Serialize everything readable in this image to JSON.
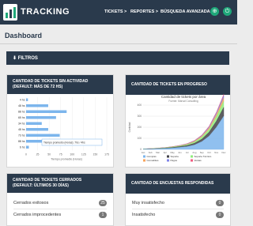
{
  "header": {
    "brand": "TRACKING",
    "nav": [
      "TICKETS >",
      "REPORTES >",
      "BÚSQUEDA AVANZADA >"
    ],
    "icon1": "account-icon",
    "icon2": "logout-icon"
  },
  "page": {
    "title": "Dashboard"
  },
  "filters": {
    "label": "⬇ FILTROS"
  },
  "cards": {
    "inactive": {
      "title_1": "CANTIDAD DE TICKETS SIN ACTIVIDAD",
      "title_2": "(DEFAULT: MÁS DE 72 HS)"
    },
    "progress": {
      "title": "CANTIDAD DE TICKETS EN PROGRESO"
    },
    "closed": {
      "title_1": "CANTIDAD DE TICKETS CERRADOS",
      "title_2": "(DEFAULT: ÚLTIMOS 30 DÍAS)",
      "rows": [
        {
          "label": "Cerrados exitosos",
          "count": "25"
        },
        {
          "label": "Cerrados improcedentes",
          "count": "1"
        }
      ]
    },
    "surveys": {
      "title": "CANTIDAD DE ENCUESTAS RESPONDIDAS",
      "rows": [
        {
          "label": "Muy insatisfecho",
          "count": "0"
        },
        {
          "label": "Insatisfecho",
          "count": "0"
        }
      ]
    }
  },
  "chart_data": [
    {
      "type": "bar",
      "orientation": "horizontal",
      "xlabel": "Tiempo promedio (Horas)",
      "xticks": [
        "0",
        "25",
        "50",
        "75",
        "100",
        "125",
        "150",
        "175"
      ],
      "xlim": [
        0,
        175
      ],
      "data_labels": [
        "4 hs",
        "48 hs",
        "88 hs",
        "65 hs",
        "34 hs",
        "48 hs",
        "73 hs",
        "88 hs",
        "6 hs"
      ],
      "values": [
        4,
        48,
        88,
        65,
        34,
        48,
        73,
        88,
        6
      ],
      "tooltip": "Tiempo promedio (Horas): 7hs / 4hs"
    },
    {
      "type": "area",
      "title": "Cantidad de tickets por área",
      "subtitle": "Fuente: Marval Consulting",
      "ylabel": "Cantidad",
      "xticks": [
        "Jan",
        "Feb",
        "Mar",
        "Apr",
        "May",
        "Jun",
        "Jul",
        "Aug",
        "Sep",
        "Oct",
        "Nov",
        "Dec"
      ],
      "yticks": [
        "0",
        "100",
        "200",
        "300",
        "400"
      ],
      "ylim": [
        0,
        400
      ],
      "series": [
        {
          "name": "Compras",
          "color": "#7cb5ec",
          "values": [
            2,
            3,
            5,
            8,
            12,
            18,
            25,
            40,
            70,
            120,
            200,
            300
          ]
        },
        {
          "name": "Soporte",
          "color": "#434348",
          "values": [
            1,
            2,
            2,
            3,
            5,
            7,
            10,
            15,
            22,
            35,
            55,
            80
          ]
        },
        {
          "name": "Soporte Técnico",
          "color": "#90ed7d",
          "values": [
            1,
            1,
            2,
            3,
            4,
            5,
            8,
            12,
            18,
            25,
            40,
            55
          ]
        },
        {
          "name": "Comodities",
          "color": "#f7a35c",
          "values": [
            0,
            1,
            1,
            1,
            2,
            3,
            4,
            6,
            9,
            14,
            20,
            30
          ]
        },
        {
          "name": "Pagos",
          "color": "#8085e9",
          "values": [
            0,
            0,
            1,
            1,
            1,
            2,
            3,
            4,
            6,
            9,
            14,
            20
          ]
        },
        {
          "name": "Ventas",
          "color": "#f15c80",
          "values": [
            0,
            0,
            0,
            1,
            1,
            1,
            2,
            3,
            4,
            6,
            8,
            12
          ]
        }
      ]
    }
  ]
}
